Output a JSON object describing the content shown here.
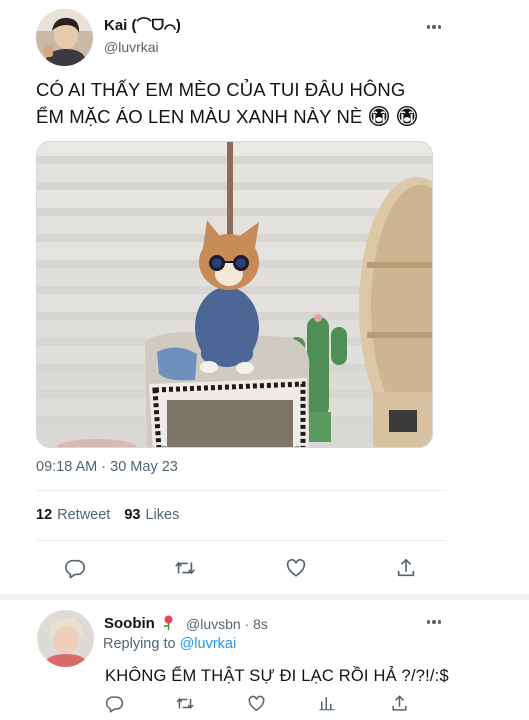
{
  "tweet": {
    "author_name": "Kai (⌒ᗜ⌒)",
    "author_handle": "@luvrkai",
    "text_line1": "CÓ AI THẤY EM MÈO CỦA TUI ĐÂU HÔNG",
    "text_line2": "ỂM MẶC ÁO LEN MÀU XANH NÀY NÈ",
    "emojis": [
      "loudly-crying-face-icon",
      "loudly-crying-face-icon"
    ],
    "media_description_icon": "cat-photo",
    "timestamp": "09:18 AM · 30 May 23",
    "retweets_count": "12",
    "retweets_label": "Retweet",
    "likes_count": "93",
    "likes_label": "Likes"
  },
  "reply": {
    "author_name": "Soobin",
    "author_emoji": "rose-icon",
    "author_handle_time": "@luvsbn · 8s",
    "replying_to_prefix": "Replying to",
    "replying_to_handle": "@luvrkai",
    "text": "KHÔNG ỂM THẬT SỰ ĐI LẠC RỒI HẢ ?/?!/:$"
  },
  "colors": {
    "primary_text": "#0f1419",
    "secondary_text": "#536471",
    "link": "#1d9bf0",
    "divider": "#e6ecf0"
  }
}
